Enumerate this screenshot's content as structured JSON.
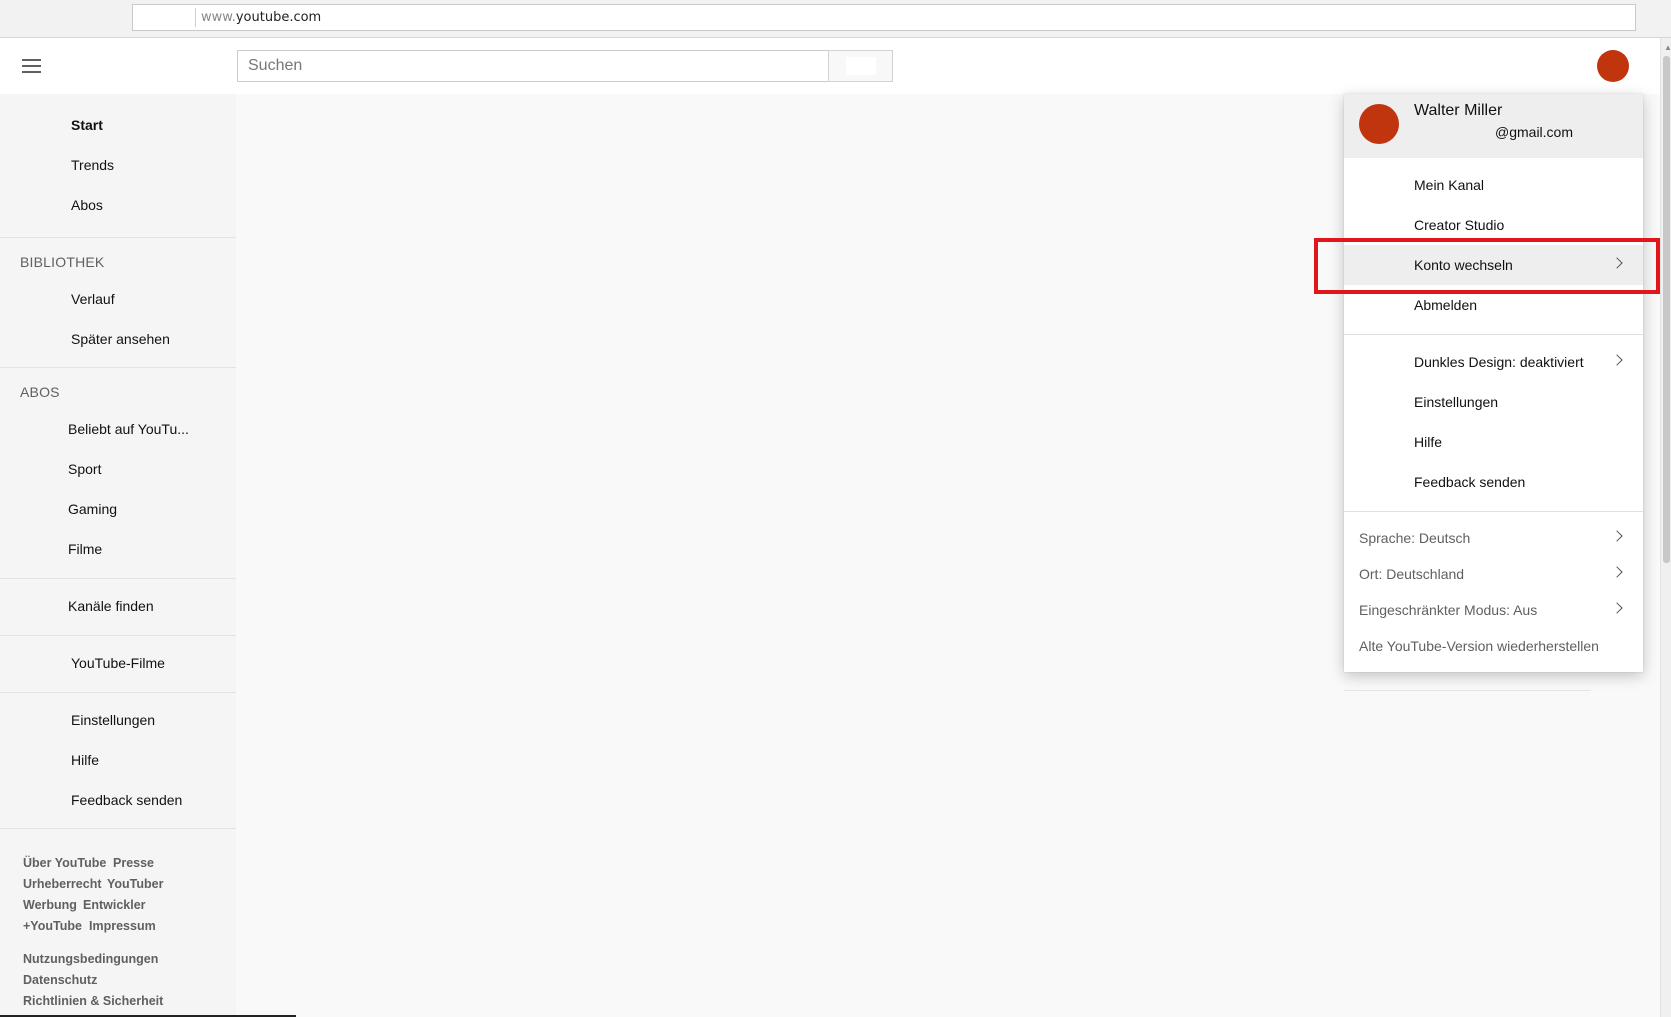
{
  "browser": {
    "url_prefix": "www.",
    "url_domain": "youtube.com"
  },
  "header": {
    "search_placeholder": "Suchen",
    "icons": [
      "menu-icon",
      "search-icon",
      "avatar"
    ],
    "avatar_color": "#c1350e"
  },
  "sidebar": {
    "main": [
      {
        "label": "Start",
        "active": true
      },
      {
        "label": "Trends"
      },
      {
        "label": "Abos"
      }
    ],
    "library_title": "BIBLIOTHEK",
    "library": [
      {
        "label": "Verlauf"
      },
      {
        "label": "Später ansehen"
      }
    ],
    "subs_title": "ABOS",
    "subs": [
      {
        "label": "Beliebt auf YouTu..."
      },
      {
        "label": "Sport"
      },
      {
        "label": "Gaming"
      },
      {
        "label": "Filme"
      }
    ],
    "find_channels": "Kanäle finden",
    "youtube_movies": "YouTube-Filme",
    "settings": [
      {
        "label": "Einstellungen"
      },
      {
        "label": "Hilfe"
      },
      {
        "label": "Feedback senden"
      }
    ],
    "footer": {
      "row1": [
        "Über YouTube",
        "Presse"
      ],
      "row2": [
        "Urheberrecht",
        "YouTuber"
      ],
      "row3": [
        "Werbung",
        "Entwickler"
      ],
      "row4": [
        "+YouTube",
        "Impressum"
      ],
      "legal": [
        "Nutzungsbedingungen",
        "Datenschutz",
        "Richtlinien & Sicherheit"
      ]
    }
  },
  "account_menu": {
    "name": "Walter Miller",
    "email": "@gmail.com",
    "group1": [
      {
        "label": "Mein Kanal"
      },
      {
        "label": "Creator Studio"
      },
      {
        "label": "Konto wechseln",
        "chevron": true
      },
      {
        "label": "Abmelden"
      }
    ],
    "group2": [
      {
        "label": "Dunkles Design: deaktiviert",
        "chevron": true
      },
      {
        "label": "Einstellungen"
      },
      {
        "label": "Hilfe"
      },
      {
        "label": "Feedback senden"
      }
    ],
    "group3": [
      {
        "label": "Sprache: Deutsch",
        "chevron": true
      },
      {
        "label": "Ort: Deutschland",
        "chevron": true
      },
      {
        "label": "Eingeschränkter Modus: Aus",
        "chevron": true
      },
      {
        "label": "Alte YouTube-Version wiederherstellen"
      }
    ],
    "highlight_color": "#e0161c"
  }
}
